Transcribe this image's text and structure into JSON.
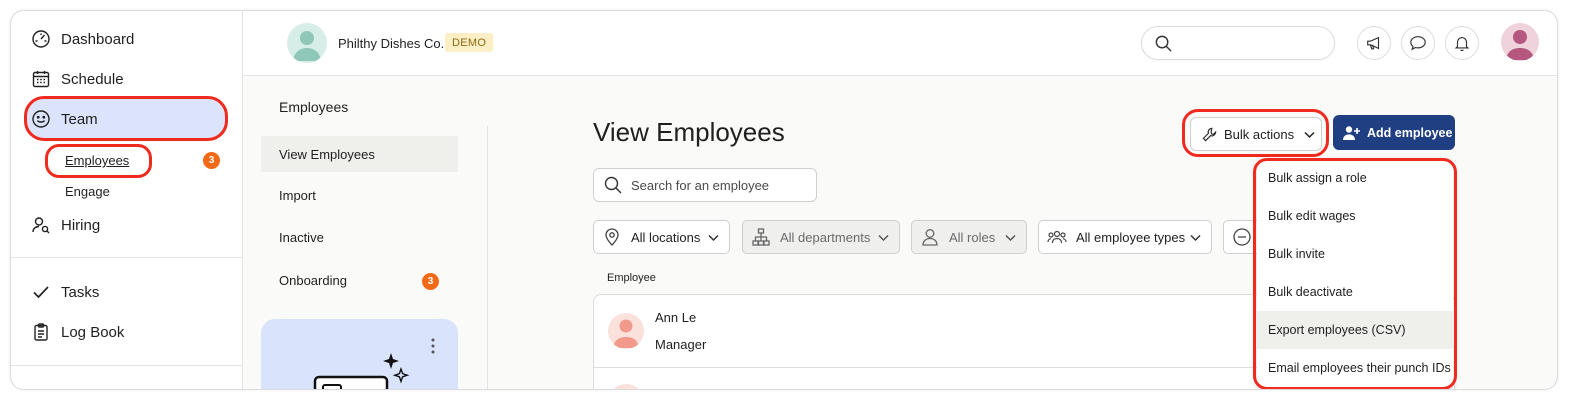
{
  "sidebar": {
    "items": [
      {
        "label": "Dashboard",
        "icon": "speedometer-icon"
      },
      {
        "label": "Schedule",
        "icon": "calendar-icon"
      },
      {
        "label": "Team",
        "icon": "smiley-icon"
      },
      {
        "label": "Hiring",
        "icon": "person-search-icon"
      },
      {
        "label": "Tasks",
        "icon": "checkmark-icon"
      },
      {
        "label": "Log Book",
        "icon": "clipboard-icon"
      }
    ],
    "team_sub": [
      {
        "label": "Employees",
        "badge": "3"
      },
      {
        "label": "Engage"
      }
    ]
  },
  "topbar": {
    "company_name": "Philthy Dishes Co.",
    "demo_badge": "DEMO",
    "search_placeholder": ""
  },
  "secondary": {
    "title": "Employees",
    "items": [
      {
        "label": "View Employees"
      },
      {
        "label": "Import"
      },
      {
        "label": "Inactive"
      },
      {
        "label": "Onboarding",
        "badge": "3"
      }
    ]
  },
  "main": {
    "title": "View Employees",
    "search_placeholder": "Search for an employee",
    "filters": [
      {
        "label": "All locations",
        "icon": "location-pin-icon"
      },
      {
        "label": "All departments",
        "icon": "org-chart-icon"
      },
      {
        "label": "All roles",
        "icon": "person-icon"
      },
      {
        "label": "All employee types",
        "icon": "people-group-icon"
      }
    ],
    "column_header": "Employee",
    "employees": [
      {
        "name": "Ann Le",
        "role": "Manager"
      }
    ],
    "bulk_actions_label": "Bulk actions",
    "add_employee_label": "Add employee",
    "bulk_menu": [
      "Bulk assign a role",
      "Bulk edit wages",
      "Bulk invite",
      "Bulk deactivate",
      "Export employees (CSV)",
      "Email employees their punch IDs"
    ]
  },
  "colors": {
    "accent_blue": "#1f3f82",
    "team_highlight": "#dce4fb",
    "badge_orange": "#f26a16",
    "annotation_red": "#ef2a1f"
  }
}
